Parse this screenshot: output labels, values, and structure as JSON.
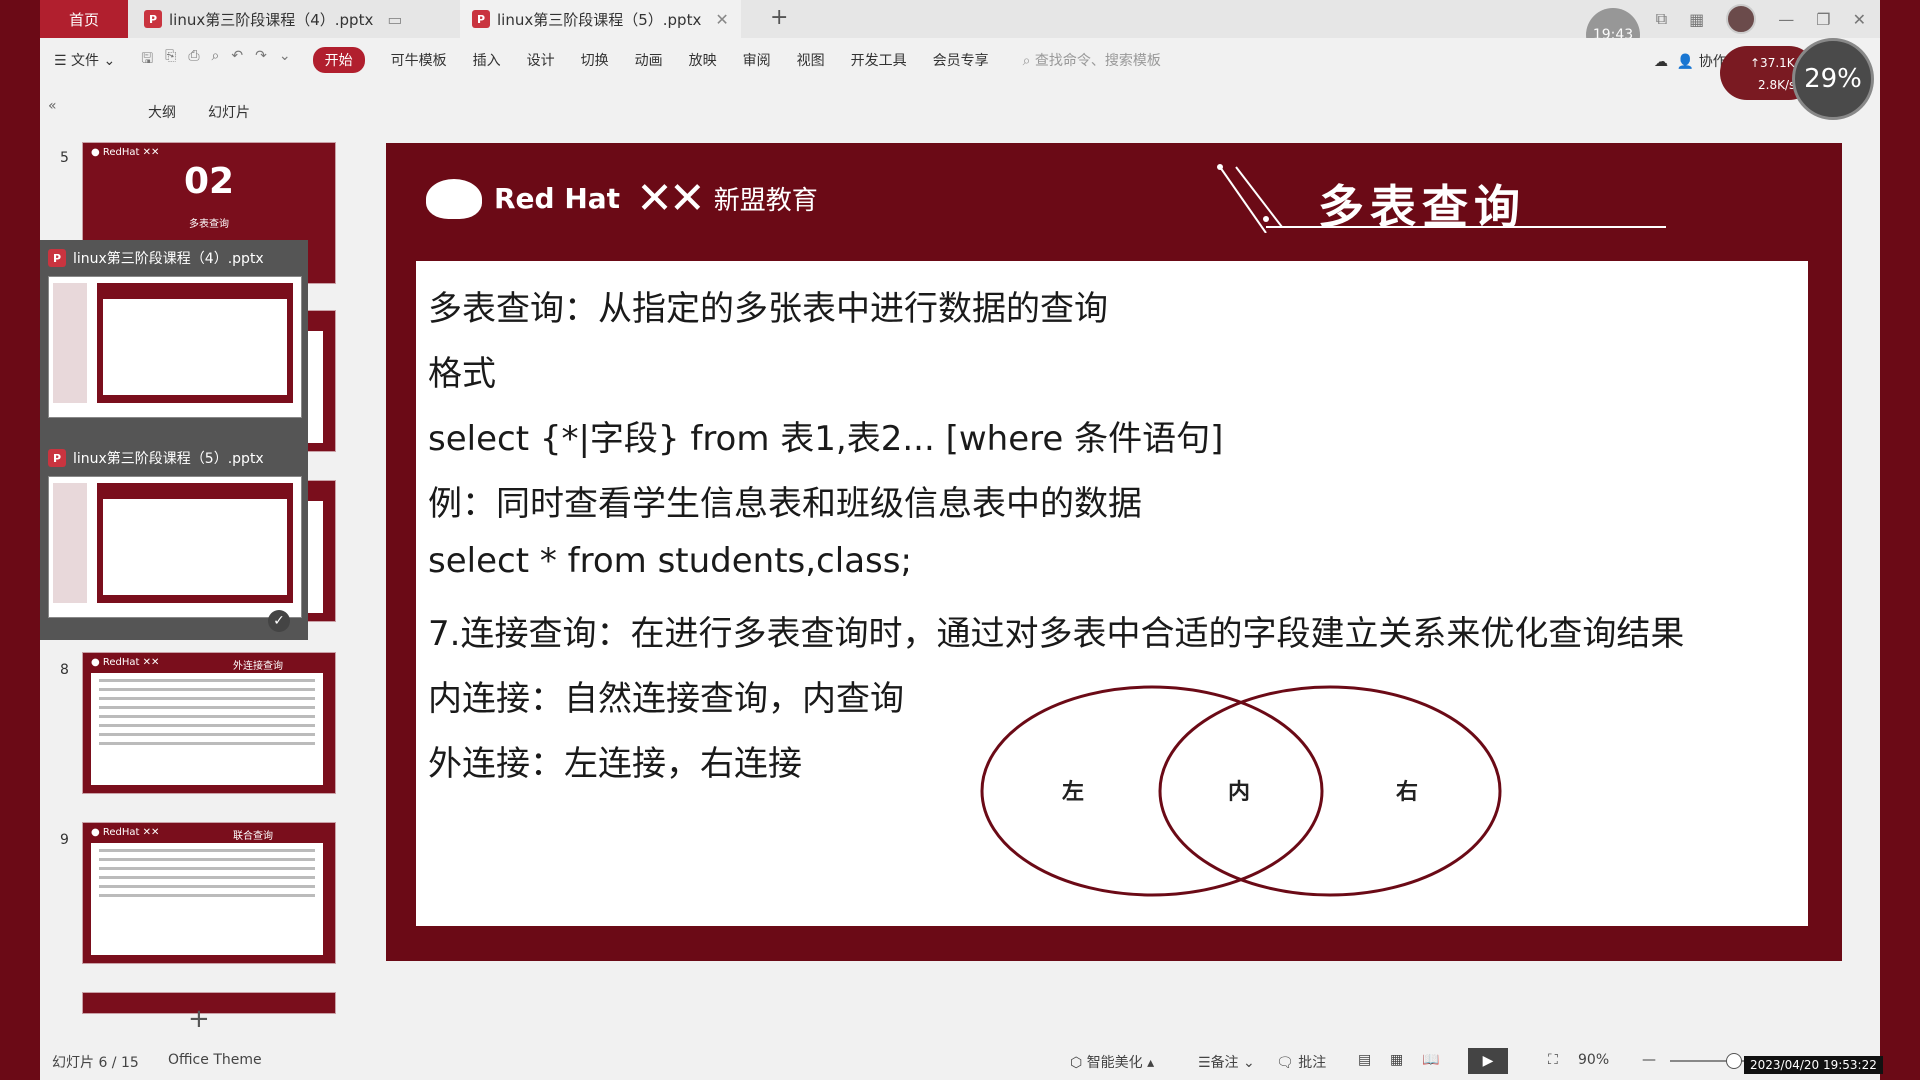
{
  "tabs": {
    "home": "首页",
    "doc1": "linux第三阶段课程（4）.pptx",
    "doc2": "linux第三阶段课程（5）.pptx",
    "add": "+"
  },
  "clock": "19:43",
  "ribbon": {
    "file": "文件",
    "items": [
      "开始",
      "可牛模板",
      "插入",
      "设计",
      "切换",
      "动画",
      "放映",
      "审阅",
      "视图",
      "开发工具",
      "会员专享"
    ],
    "search_placeholder": "查找命令、搜索模板",
    "collab": "协作"
  },
  "network": {
    "up": "↑37.1K/s",
    "down": "2.8K/s"
  },
  "cpu": "29%",
  "panel": {
    "outline": "大纲",
    "slides": "幻灯片",
    "collapse": "«"
  },
  "thumbnails": {
    "n5": "5",
    "t5_big": "02",
    "t5_sub": "多表查询",
    "n8": "8",
    "t8_title": "外连接查询",
    "n9": "9",
    "t9_title": "联合查询",
    "popup1": "linux第三阶段课程（4）.pptx",
    "popup2": "linux第三阶段课程（5）.pptx"
  },
  "slide": {
    "brand_redhat": "Red Hat",
    "brand_xm": "新盟教育",
    "title": "多表查询",
    "lines": [
      "多表查询：从指定的多张表中进行数据的查询",
      "格式",
      "select {*|字段} from 表1,表2... [where 条件语句]",
      "例：同时查看学生信息表和班级信息表中的数据",
      "select * from students,class;",
      "7.连接查询：在进行多表查询时，通过对多表中合适的字段建立关系来优化查询结果",
      "内连接：自然连接查询，内查询",
      "外连接：左连接，右连接"
    ],
    "venn": {
      "left": "左",
      "inner": "内",
      "right": "右"
    }
  },
  "status": {
    "slide_count": "幻灯片 6 / 15",
    "theme": "Office Theme",
    "beautify": "智能美化",
    "notes": "备注",
    "comment": "批注",
    "zoom": "90%",
    "datetime": "2023/04/20 19:53:22"
  },
  "colors": {
    "brand": "#6b0a16",
    "accent": "#b11f2e"
  }
}
